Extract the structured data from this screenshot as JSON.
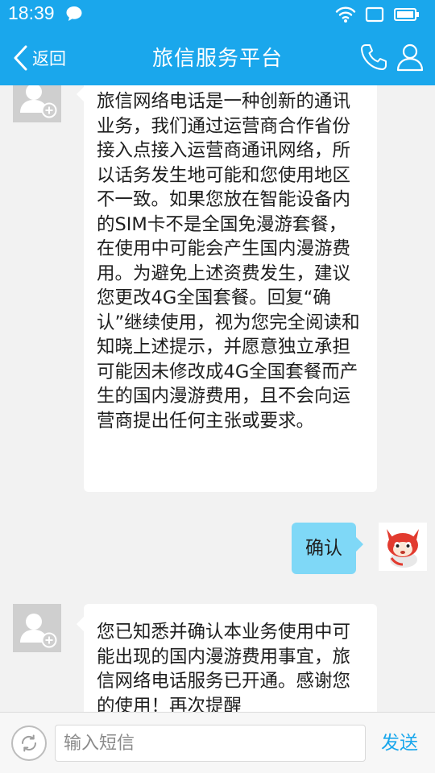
{
  "status_bar": {
    "time": "18:39",
    "icons": [
      "message-bubble-icon",
      "wifi-icon",
      "screen-rotate-icon",
      "battery-icon"
    ]
  },
  "header": {
    "back_label": "返回",
    "title": "旅信服务平台",
    "icons": [
      "back-chevron-icon",
      "phone-icon",
      "contact-icon"
    ]
  },
  "messages": [
    {
      "direction": "incoming",
      "text": "旅信网络电话是一种创新的通讯业务，我们通过运营商合作省份接入点接入运营商通讯网络，所以话务发生地可能和您使用地区不一致。如果您放在智能设备内的SIM卡不是全国免漫游套餐，在使用中可能会产生国内漫游费用。为避免上述资费发生，建议您更改4G全国套餐。回复“确认”继续使用，视为您完全阅读和知晓上述提示，并愿意独立承担可能因未修改成4G全国套餐而产生的国内漫游费用，且不会向运营商提出任何主张或要求。"
    },
    {
      "direction": "outgoing",
      "text": "确认"
    },
    {
      "direction": "incoming",
      "text": "您已知悉并确认本业务使用中可能出现的国内漫游费用事宜，旅信网络电话服务已开通。感谢您的使用！再次提醒"
    }
  ],
  "input_bar": {
    "placeholder": "输入短信",
    "send_label": "发送",
    "icons": [
      "switch-sim-icon"
    ]
  },
  "colors": {
    "header_bg": "#1aa7ec",
    "outgoing_bubble": "#7fd8f7",
    "incoming_bubble": "#ffffff",
    "chat_bg": "#f2f2f2",
    "send_text": "#1aa7ec"
  }
}
